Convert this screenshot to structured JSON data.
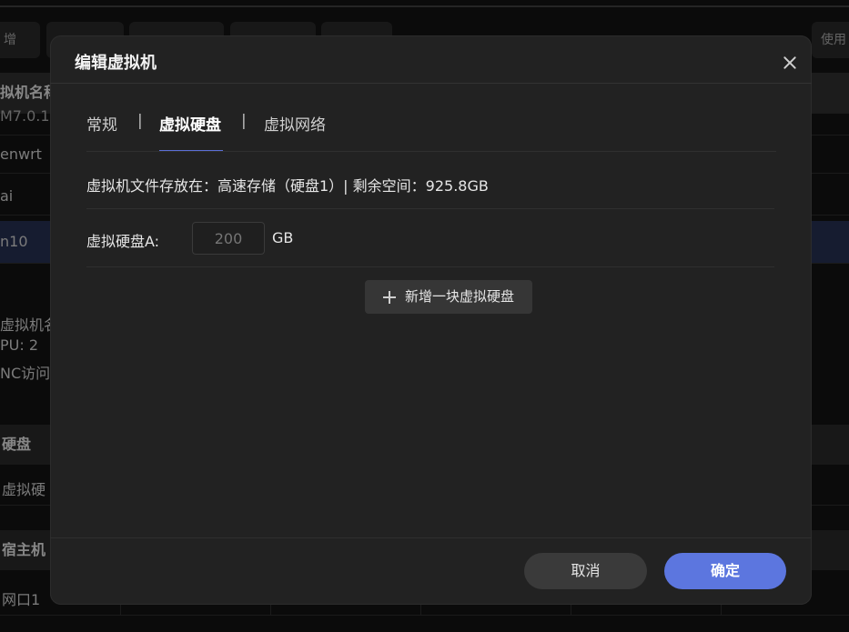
{
  "background": {
    "toolbar": {
      "left_label": "增",
      "right_label": "使用"
    },
    "table": {
      "header": "拟机名称",
      "header_partial": "M7.0.1",
      "rows": [
        "enwrt",
        "ai",
        "n10"
      ]
    },
    "detail": {
      "name_label": "虚拟机名",
      "cpu_label": "PU: 2",
      "vnc_label": "NC访问"
    },
    "sections": {
      "disk_header": "硬盘",
      "disk_row": "虚拟硬",
      "host_header": "宿主机",
      "host_row": "网口1"
    }
  },
  "dialog": {
    "title": "编辑虚拟机",
    "tabs": [
      {
        "label": "常规"
      },
      {
        "label": "虚拟硬盘",
        "active": true
      },
      {
        "label": "虚拟网络"
      }
    ],
    "tab_separator": "|",
    "storage_info": "虚拟机文件存放在：高速存储（硬盘1）| 剩余空间：925.8GB",
    "disk": {
      "label": "虚拟硬盘A:",
      "value": "200",
      "unit": "GB"
    },
    "add_disk_label": "新增一块虚拟硬盘",
    "cancel_label": "取消",
    "ok_label": "确定"
  },
  "colors": {
    "accent": "#5c76df",
    "dialog_bg": "#222222"
  }
}
